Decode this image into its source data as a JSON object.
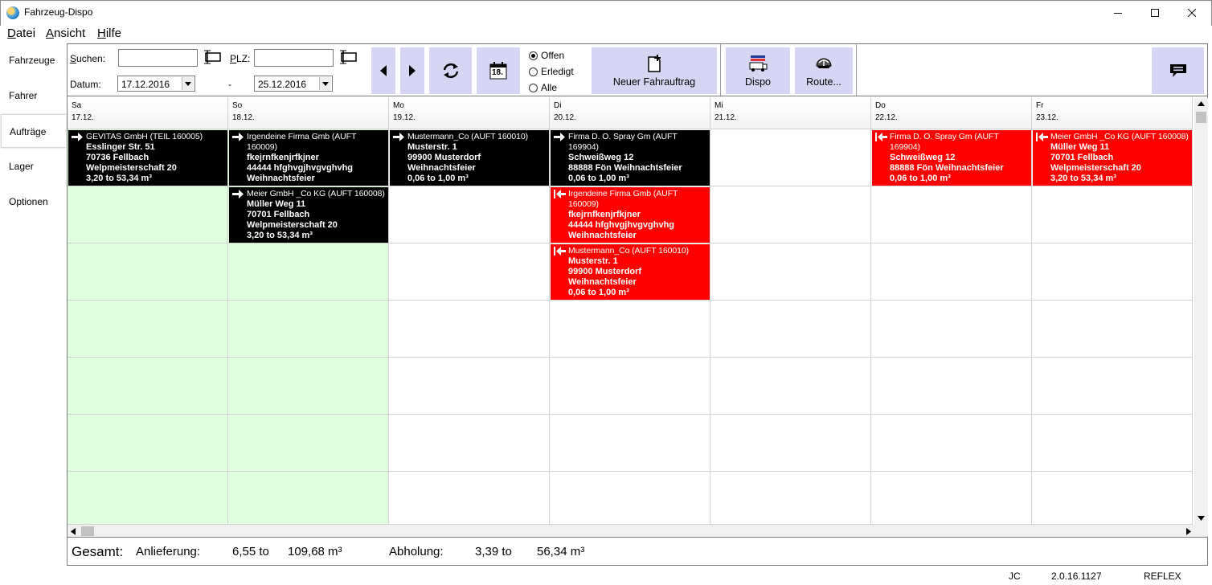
{
  "window": {
    "title": "Fahrzeug-Dispo",
    "minimize": "minimize",
    "maximize": "maximize",
    "close": "close"
  },
  "menu": [
    {
      "first": "D",
      "rest": "atei"
    },
    {
      "first": "A",
      "rest": "nsicht"
    },
    {
      "first": "H",
      "rest": "ilfe"
    }
  ],
  "nav": [
    "Fahrzeuge",
    "Fahrer",
    "Aufträge",
    "Lager",
    "Optionen"
  ],
  "nav_active": "Aufträge",
  "toolbar": {
    "search_label_first": "S",
    "search_label_rest": "uchen:",
    "plz_label_first": "P",
    "plz_label_rest": "LZ:",
    "search_value": "",
    "plz_value": "",
    "date_label": "Datum:",
    "date_from": "17.12.2016",
    "date_sep": "-",
    "date_to": "25.12.2016",
    "calendar_day": "18.",
    "radio": [
      {
        "label": "Offen",
        "checked": true
      },
      {
        "label": "Erledigt",
        "checked": false
      },
      {
        "label": "Alle",
        "checked": false
      }
    ],
    "new_order": "Neuer Fahrauftrag",
    "dispo": "Dispo",
    "route": "Route..."
  },
  "days": [
    {
      "dow": "Sa",
      "date": "17.12."
    },
    {
      "dow": "So",
      "date": "18.12."
    },
    {
      "dow": "Mo",
      "date": "19.12."
    },
    {
      "dow": "Di",
      "date": "20.12."
    },
    {
      "dow": "Mi",
      "date": "21.12."
    },
    {
      "dow": "Do",
      "date": "22.12."
    },
    {
      "dow": "Fr",
      "date": "23.12."
    }
  ],
  "orders": [
    {
      "day": 0,
      "row": 0,
      "color": "black",
      "dir": "out",
      "head": "GEVITAS GmbH (TEIL 160005)",
      "l1": "Esslinger Str. 51",
      "l2": "70736 Fellbach",
      "l3": "Welpmeisterschaft 20",
      "l4": "3,20 to 53,34 m³"
    },
    {
      "day": 1,
      "row": 0,
      "color": "black",
      "dir": "out",
      "head": "Irgendeine Firma Gmb (AUFT 160009)",
      "l1": "fkejrnfkenjrfkjner",
      "l2": "44444 hfghvgjhvgvghvhg",
      "l3": "Weihnachtsfeier",
      "l4": ""
    },
    {
      "day": 2,
      "row": 0,
      "color": "black",
      "dir": "out",
      "head": "Mustermann_Co (AUFT 160010)",
      "l1": "Musterstr. 1",
      "l2": "99900 Musterdorf",
      "l3": "Weihnachtsfeier",
      "l4": "0,06 to 1,00 m³"
    },
    {
      "day": 3,
      "row": 0,
      "color": "black",
      "dir": "out",
      "head": "Firma D. O. Spray Gm (AUFT 169904)",
      "l1": "Schweißweg 12",
      "l2": "88888 Fön Weihnachtsfeier",
      "l3": "0,06 to 1,00 m³",
      "l4": ""
    },
    {
      "day": 5,
      "row": 0,
      "color": "red",
      "dir": "in",
      "head": "Firma D. O. Spray Gm (AUFT 169904)",
      "l1": "Schweißweg 12",
      "l2": "88888 Fön Weihnachtsfeier",
      "l3": "0,06 to 1,00 m³",
      "l4": ""
    },
    {
      "day": 6,
      "row": 0,
      "color": "red",
      "dir": "in",
      "head": "Meier GmbH _Co KG (AUFT 160008)",
      "l1": "Müller Weg 11",
      "l2": "70701 Fellbach",
      "l3": "Welpmeisterschaft 20",
      "l4": "3,20 to 53,34 m³"
    },
    {
      "day": 1,
      "row": 1,
      "color": "black",
      "dir": "out",
      "head": "Meier GmbH _Co KG (AUFT 160008)",
      "l1": "Müller Weg 11",
      "l2": "70701 Fellbach",
      "l3": "Welpmeisterschaft 20",
      "l4": "3,20 to 53,34 m³"
    },
    {
      "day": 3,
      "row": 1,
      "color": "red",
      "dir": "in",
      "head": "Irgendeine Firma Gmb (AUFT 160009)",
      "l1": "fkejrnfkenjrfkjner",
      "l2": "44444 hfghvgjhvgvghvhg",
      "l3": "Weihnachtsfeier",
      "l4": ""
    },
    {
      "day": 3,
      "row": 2,
      "color": "red",
      "dir": "in",
      "head": "Mustermann_Co (AUFT 160010)",
      "l1": "Musterstr. 1",
      "l2": "99900 Musterdorf",
      "l3": "Weihnachtsfeier",
      "l4": "0,06 to 1,00 m³"
    }
  ],
  "footer": {
    "total": "Gesamt:",
    "delivery_label": "Anlieferung:",
    "delivery_to": "6,55 to",
    "delivery_m3": "109,68 m³",
    "pickup_label": "Abholung:",
    "pickup_to": "3,39 to",
    "pickup_m3": "56,34 m³"
  },
  "status": {
    "user": "JC",
    "version": "2.0.16.1127",
    "db": "REFLEX"
  },
  "colors": {
    "button_bg": "#d6d6f4",
    "weekend_bg": "#dfffdf",
    "card_red": "#ff0000",
    "card_black": "#000000"
  }
}
